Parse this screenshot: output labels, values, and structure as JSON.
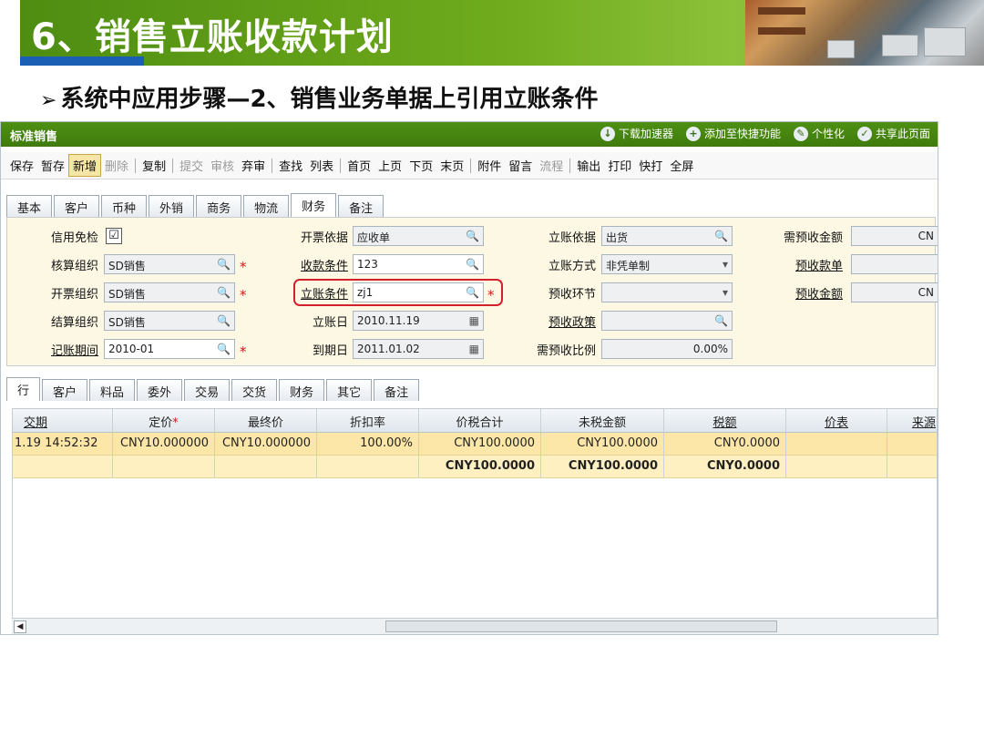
{
  "slide": {
    "title": "6、销售立账收款计划",
    "bullet": "系统中应用步骤—2、销售业务单据上引用立账条件"
  },
  "app": {
    "title": "标准销售",
    "header_links": [
      "下载加速器",
      "添加至快捷功能",
      "个性化",
      "共享此页面"
    ],
    "toolbar": [
      "保存",
      "暂存",
      "新增",
      "删除",
      "复制",
      "提交",
      "审核",
      "弃审",
      "查找",
      "列表",
      "首页",
      "上页",
      "下页",
      "末页",
      "附件",
      "留言",
      "流程",
      "输出",
      "打印",
      "快打",
      "全屏"
    ],
    "tabs": [
      "基本",
      "客户",
      "币种",
      "外销",
      "商务",
      "物流",
      "财务",
      "备注"
    ],
    "active_tab": "财务",
    "form": {
      "col1": [
        {
          "label": "信用免检",
          "value": "☑"
        },
        {
          "label": "核算组织",
          "value": "SD销售"
        },
        {
          "label": "开票组织",
          "value": "SD销售"
        },
        {
          "label": "结算组织",
          "value": "SD销售"
        },
        {
          "label": "记账期间",
          "value": "2010-01"
        }
      ],
      "col2": [
        {
          "label": "开票依据",
          "value": "应收单"
        },
        {
          "label": "收款条件",
          "value": "123"
        },
        {
          "label": "立账条件",
          "value": "zj1"
        },
        {
          "label": "立账日",
          "value": "2010.11.19"
        },
        {
          "label": "到期日",
          "value": "2011.01.02"
        }
      ],
      "col3": [
        {
          "label": "立账依据",
          "value": "出货"
        },
        {
          "label": "立账方式",
          "value": "非凭单制"
        },
        {
          "label": "预收环节",
          "value": ""
        },
        {
          "label": "预收政策",
          "value": ""
        },
        {
          "label": "需预收比例",
          "value": "0.00%"
        }
      ],
      "col4": [
        {
          "label": "需预收金额",
          "value": "CN"
        },
        {
          "label": "预收款单",
          "value": ""
        },
        {
          "label": "预收金额",
          "value": "CN"
        }
      ],
      "required_mark": "*"
    },
    "line_tabs": [
      "行",
      "客户",
      "料品",
      "委外",
      "交易",
      "交货",
      "财务",
      "其它",
      "备注"
    ],
    "active_line_tab": "行",
    "grid": {
      "headers": [
        "交期",
        "定价",
        "最终价",
        "折扣率",
        "价税合计",
        "未税金额",
        "税额",
        "价表",
        "来源"
      ],
      "rows": [
        [
          "1.19 14:52:32",
          "CNY10.000000",
          "CNY10.000000",
          "100.00%",
          "CNY100.0000",
          "CNY100.0000",
          "CNY0.0000",
          "",
          ""
        ]
      ],
      "totals": [
        "",
        "",
        "",
        "",
        "CNY100.0000",
        "CNY100.0000",
        "CNY0.0000",
        "",
        ""
      ]
    }
  }
}
